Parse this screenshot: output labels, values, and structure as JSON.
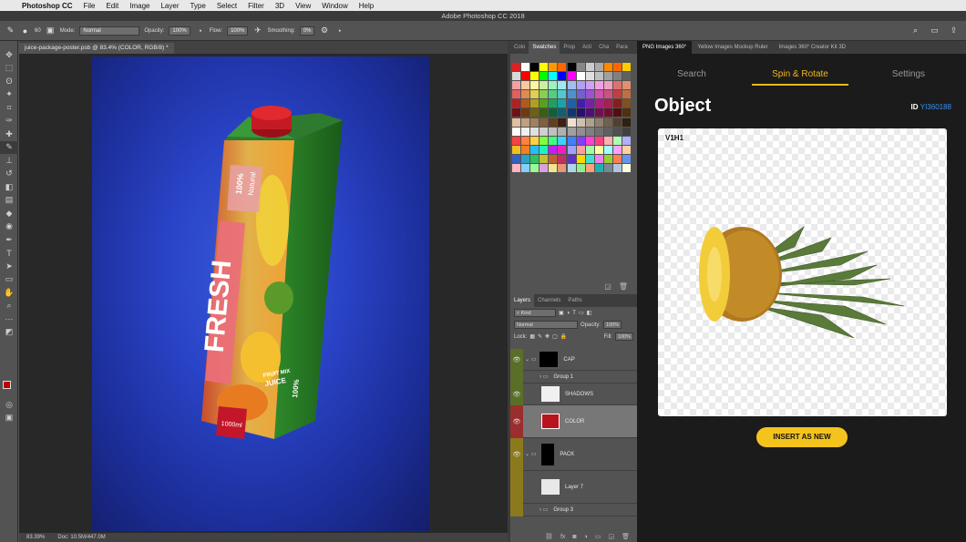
{
  "menubar": {
    "items": [
      "Photoshop CC",
      "File",
      "Edit",
      "Image",
      "Layer",
      "Type",
      "Select",
      "Filter",
      "3D",
      "View",
      "Window",
      "Help"
    ]
  },
  "window": {
    "title": "Adobe Photoshop CC 2018"
  },
  "options_bar": {
    "brush_size": "60",
    "mode_label": "Mode:",
    "mode_value": "Normal",
    "opacity_label": "Opacity:",
    "opacity_value": "100%",
    "flow_label": "Flow:",
    "flow_value": "100%",
    "smoothing_label": "Smoothing:",
    "smoothing_value": "0%"
  },
  "document": {
    "tab_label": "juice-package-poster.psb @ 83.4% (COLOR, RGB/8) *",
    "zoom": "83.39%",
    "doc_size": "Doc: 10.5M/447.0M"
  },
  "package": {
    "badge_top": "100%",
    "badge_bottom": "Natural",
    "brand": "FRESH",
    "small1": "FRUIT MIX",
    "small2": "JUICE",
    "volume": "1000ml",
    "side": "100%"
  },
  "swatch_panel": {
    "tabs": [
      "Colo",
      "Swatches",
      "Prop",
      "Acti",
      "Cha",
      "Para"
    ]
  },
  "layers_panel": {
    "tabs": [
      "Layers",
      "Channels",
      "Paths"
    ],
    "filter_value": "Kind",
    "blend_value": "Normal",
    "opacity_label": "Opacity:",
    "opacity_value": "100%",
    "lock_label": "Lock:",
    "fill_label": "Fill:",
    "fill_value": "100%",
    "layers": [
      {
        "name": "CAP",
        "type": "group",
        "color": "#5a6e28"
      },
      {
        "name": "Group 1",
        "type": "subgroup",
        "color": "#5a6e28"
      },
      {
        "name": "SHADOWS",
        "type": "layer",
        "color": "#5a6e28"
      },
      {
        "name": "COLOR",
        "type": "layer",
        "color": "#9a2e2e"
      },
      {
        "name": "PACK",
        "type": "group",
        "color": "#8a7a1c"
      },
      {
        "name": "Layer 7",
        "type": "layer",
        "color": "#8a7a1c"
      },
      {
        "name": "Group 3",
        "type": "subgroup",
        "color": "#8a7a1c"
      }
    ]
  },
  "plugin": {
    "tabs": [
      "PNG Images 360°",
      "Yellow Images Mockup Ruler",
      "Images 360° Creator Kit 3D"
    ],
    "nav": [
      "Search",
      "Spin & Rotate",
      "Settings"
    ],
    "title": "Object",
    "id_label": "ID",
    "id_value": "YI360188",
    "view_label": "V1H1",
    "insert_label": "INSERT AS NEW"
  },
  "swatch_colors": [
    "#e02020",
    "#ffffff",
    "#000000",
    "#ffff00",
    "#ff9900",
    "#ff6600",
    "#000000",
    "#888888",
    "#cccccc",
    "#aaaaaa",
    "#ff8800",
    "#ff6600",
    "#ffcc00",
    "#d9d9d9",
    "#ff0000",
    "#ffff00",
    "#00ff00",
    "#00ffff",
    "#0000ff",
    "#ff00ff",
    "#ffffff",
    "#e0e0e0",
    "#c0c0c0",
    "#a0a0a0",
    "#808080",
    "#606060",
    "#f4a0a0",
    "#f7c9a0",
    "#fff4a0",
    "#c9f0a0",
    "#a0f0c0",
    "#a0e8f0",
    "#a0c0f0",
    "#b0a0f0",
    "#d0a0f0",
    "#f0a0e0",
    "#f0a0c0",
    "#e07070",
    "#e09070",
    "#e06060",
    "#e08a50",
    "#e0d050",
    "#8ad050",
    "#50d080",
    "#50c8d0",
    "#5090d0",
    "#7060d0",
    "#a050d0",
    "#d050b0",
    "#d05080",
    "#c04040",
    "#c07040",
    "#b02020",
    "#b05a20",
    "#b0a020",
    "#5aa020",
    "#20a060",
    "#20a0a8",
    "#2060a8",
    "#4020a8",
    "#7820a8",
    "#a82080",
    "#a82050",
    "#802020",
    "#805020",
    "#701010",
    "#703810",
    "#706010",
    "#386010",
    "#106038",
    "#106070",
    "#103870",
    "#281070",
    "#501070",
    "#701050",
    "#701030",
    "#501010",
    "#503010",
    "#e0c0a0",
    "#c0a080",
    "#a08060",
    "#806040",
    "#604020",
    "#402010",
    "#f0e0d0",
    "#d0c0b0",
    "#b0a090",
    "#908070",
    "#706050",
    "#504030",
    "#302010",
    "#ffffff",
    "#f0f0f0",
    "#e0e0e0",
    "#d0d0d0",
    "#c0c0c0",
    "#b0b0b0",
    "#a0a0a0",
    "#909090",
    "#808080",
    "#707070",
    "#606060",
    "#505050",
    "#404040",
    "#ff4040",
    "#ff8040",
    "#ffd040",
    "#80ff40",
    "#40ff80",
    "#40d0ff",
    "#4080ff",
    "#8040ff",
    "#ff40d0",
    "#ff4080",
    "#ffb0b0",
    "#b0ffb0",
    "#b0b0ff",
    "#f0c020",
    "#f08020",
    "#20c0f0",
    "#20f0c0",
    "#c020f0",
    "#f020c0",
    "#a0a0ff",
    "#ffa0a0",
    "#a0ffa0",
    "#ffffa0",
    "#a0ffff",
    "#ffa0ff",
    "#ffd0a0",
    "#3060c0",
    "#30a0c0",
    "#30c060",
    "#c0c030",
    "#c06030",
    "#c03060",
    "#6030c0",
    "#ffd700",
    "#40e0d0",
    "#ee82ee",
    "#9acd32",
    "#ff7f50",
    "#6495ed",
    "#ffb6c1",
    "#87cefa",
    "#98fb98",
    "#dda0dd",
    "#f0e68c",
    "#e9967a",
    "#add8e6",
    "#90ee90",
    "#ffa07a",
    "#20b2aa",
    "#778899",
    "#b0c4de",
    "#ffffe0"
  ]
}
